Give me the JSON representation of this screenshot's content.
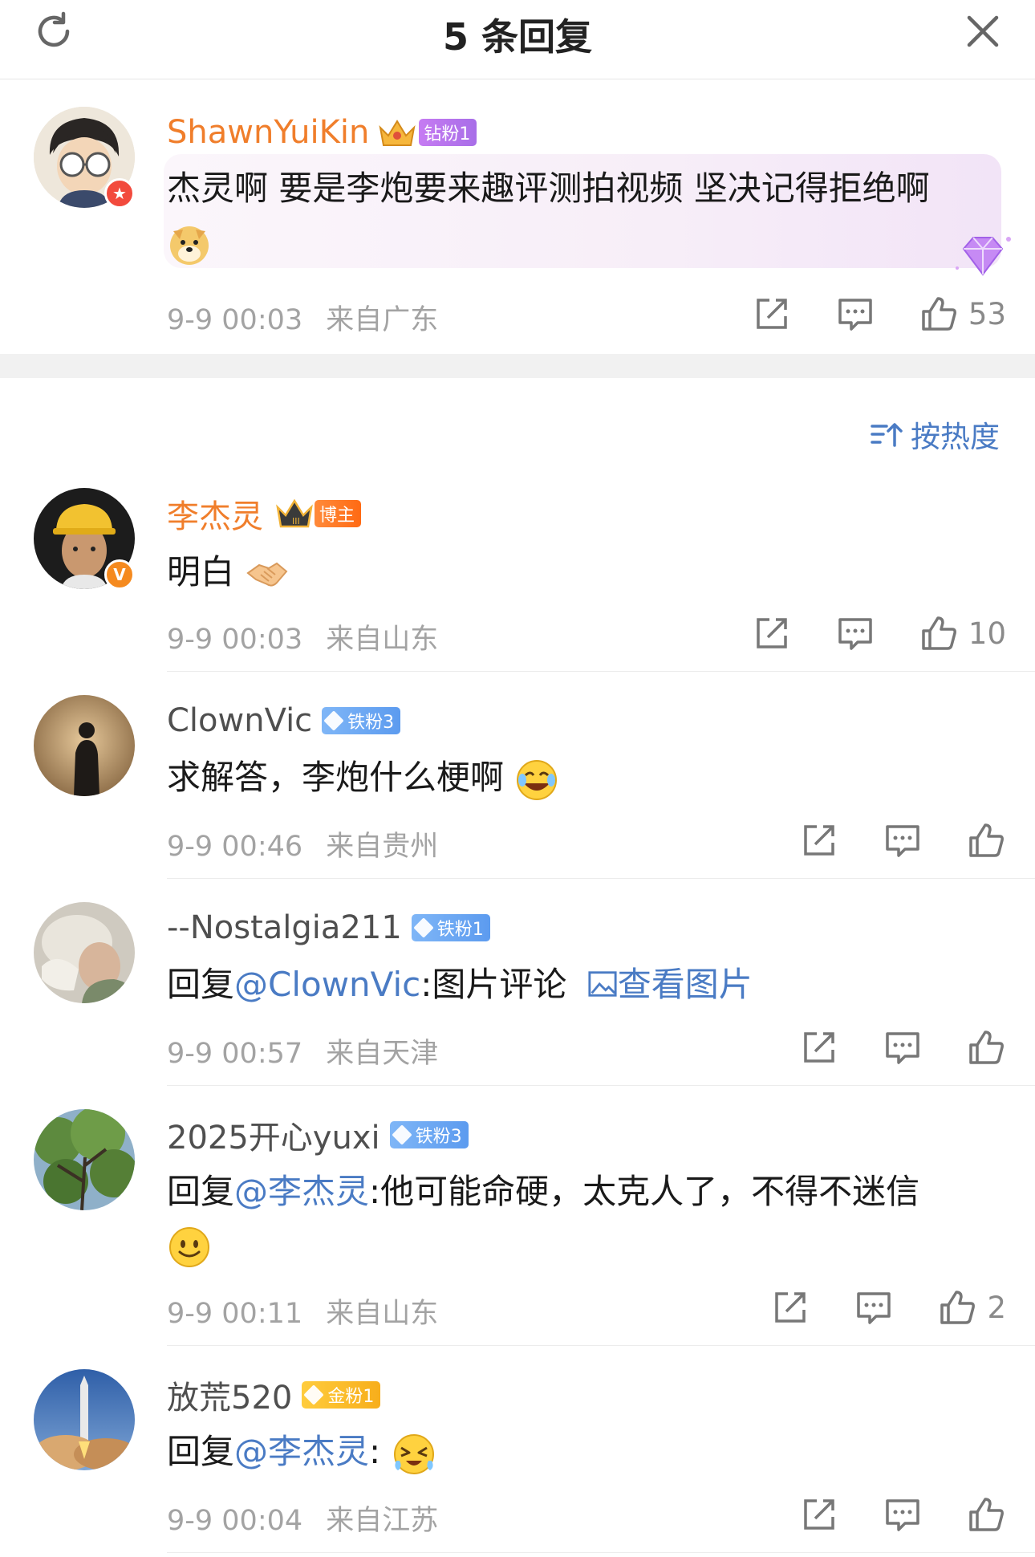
{
  "header": {
    "title": "5 条回复"
  },
  "sort": {
    "label": "按热度"
  },
  "main_comment": {
    "username": "ShawnYuiKin",
    "badge": "钻粉1",
    "text_line1": "杰灵啊 要是李炮要来趣评测拍视频 坚决记得拒绝啊",
    "time": "9-9 00:03",
    "location": "来自广东",
    "likes": "53"
  },
  "replies": [
    {
      "username": "李杰灵",
      "badge": "博主",
      "text": "明白",
      "time": "9-9 00:03",
      "location": "来自山东",
      "likes": "10"
    },
    {
      "username": "ClownVic",
      "badge": "铁粉3",
      "text": "求解答，李炮什么梗啊",
      "time": "9-9 00:46",
      "location": "来自贵州",
      "likes": ""
    },
    {
      "username": "--Nostalgia211",
      "badge": "铁粉1",
      "reply_prefix": "回复",
      "mention": "@ClownVic",
      "text": ":图片评论",
      "link": "查看图片",
      "time": "9-9 00:57",
      "location": "来自天津",
      "likes": ""
    },
    {
      "username": "2025开心yuxi",
      "badge": "铁粉3",
      "reply_prefix": "回复",
      "mention": "@李杰灵",
      "text": ":他可能命硬，太克人了，不得不迷信",
      "time": "9-9 00:11",
      "location": "来自山东",
      "likes": "2"
    },
    {
      "username": "放荒520",
      "badge": "金粉1",
      "reply_prefix": "回复",
      "mention": "@李杰灵",
      "text": ":",
      "time": "9-9 00:04",
      "location": "来自江苏",
      "likes": ""
    }
  ],
  "colors": {
    "accent_orange": "#f07e2b",
    "link_blue": "#4a7bc4",
    "meta_gray": "#a3a3a3"
  },
  "icons": [
    "refresh-icon",
    "close-icon",
    "share-icon",
    "comment-icon",
    "like-icon",
    "sort-icon",
    "image-icon"
  ]
}
